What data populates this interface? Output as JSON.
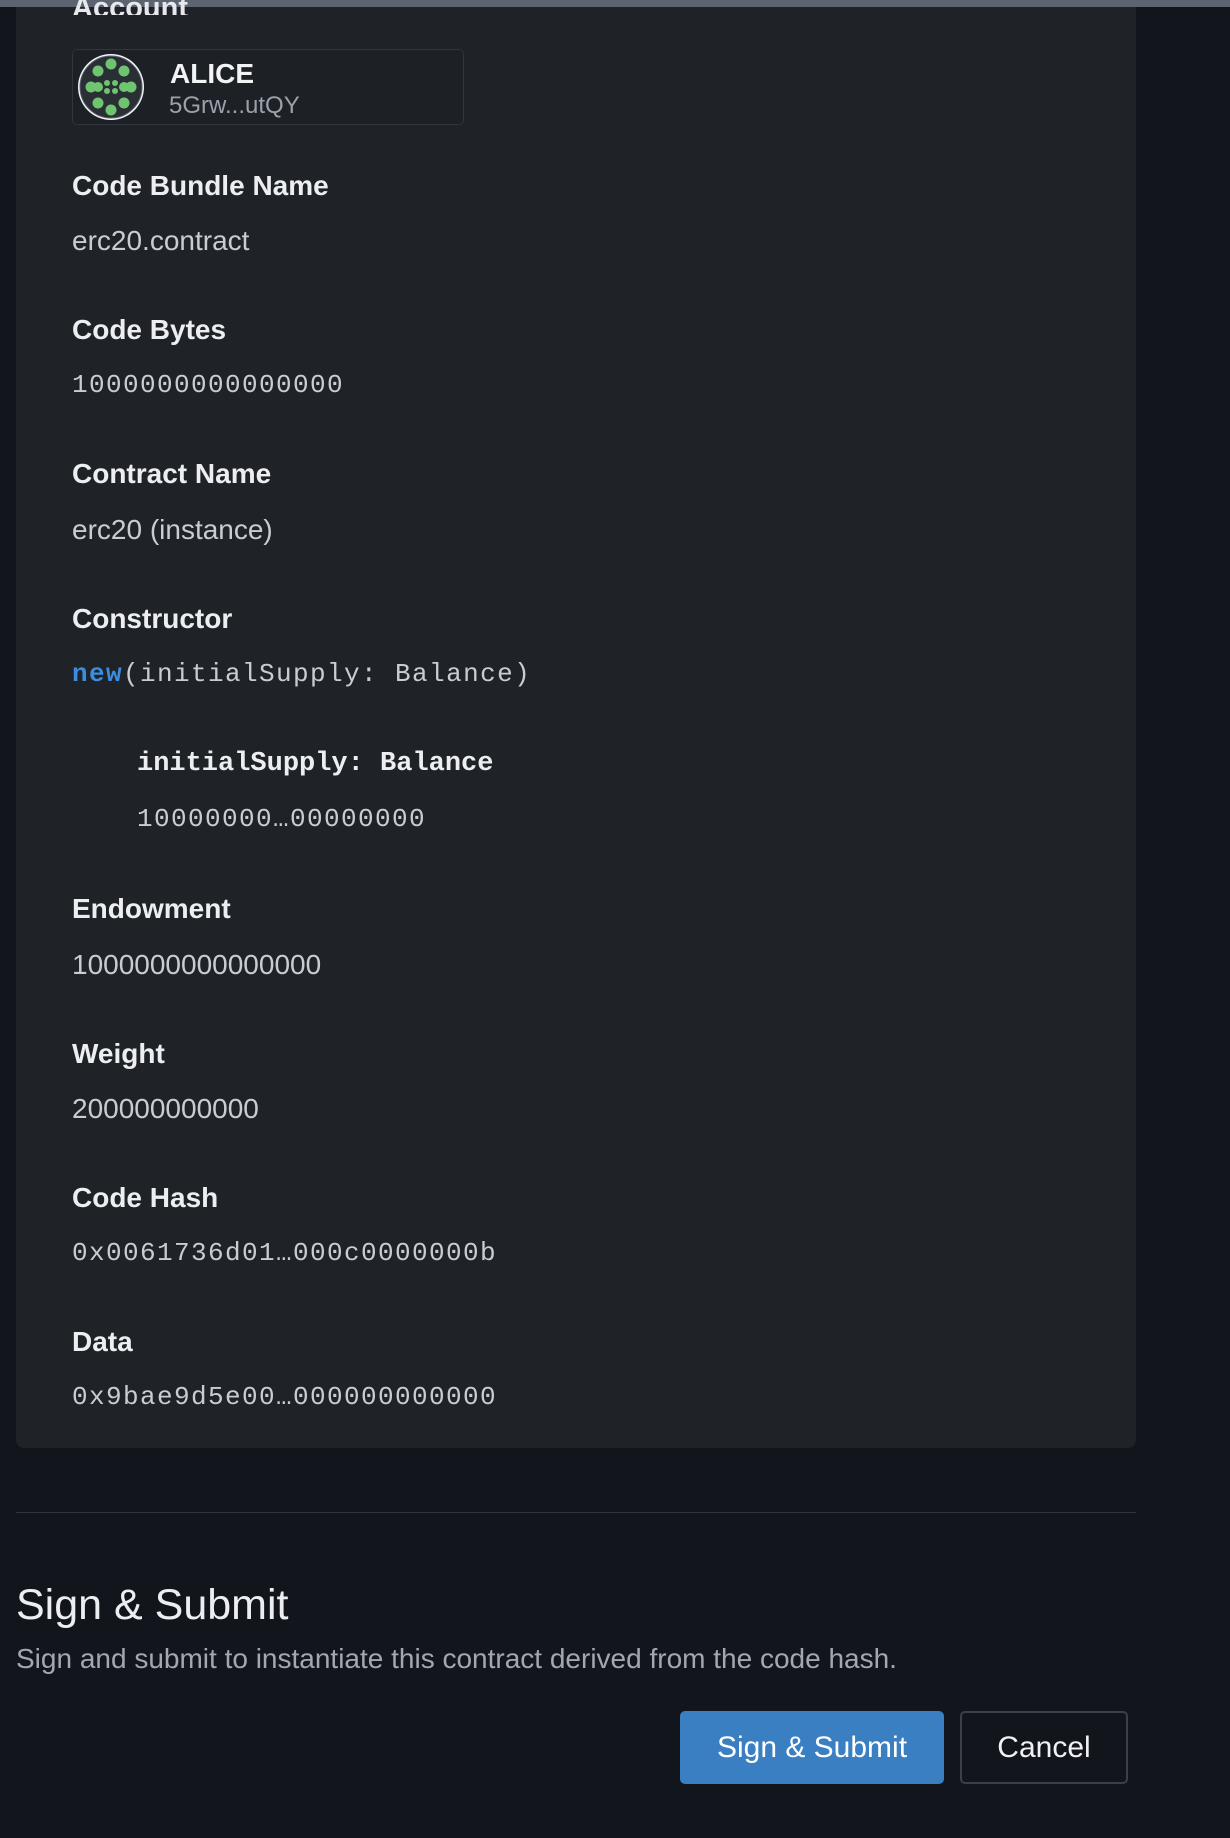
{
  "account": {
    "heading": "Account",
    "name": "ALICE",
    "address": "5Grw...utQY",
    "avatar_icon": "identicon-icon"
  },
  "fields": {
    "code_bundle_name": {
      "label": "Code Bundle Name",
      "value": "erc20.contract"
    },
    "code_bytes": {
      "label": "Code Bytes",
      "value": "1000000000000000"
    },
    "contract_name": {
      "label": "Contract Name",
      "value": "erc20 (instance)"
    },
    "constructor": {
      "label": "Constructor",
      "keyword": "new",
      "signature": "(initialSupply: Balance)",
      "arg_name": "initialSupply: Balance",
      "arg_value": "10000000…00000000"
    },
    "endowment": {
      "label": "Endowment",
      "value": "1000000000000000"
    },
    "weight": {
      "label": "Weight",
      "value": "200000000000"
    },
    "code_hash": {
      "label": "Code Hash",
      "value": "0x0061736d01…000c0000000b"
    },
    "data": {
      "label": "Data",
      "value": "0x9bae9d5e00…000000000000"
    }
  },
  "sign": {
    "title": "Sign & Submit",
    "description": "Sign and submit to instantiate this contract derived from the code hash.",
    "submit_label": "Sign & Submit",
    "cancel_label": "Cancel"
  },
  "colors": {
    "background": "#12161c",
    "card": "#1f2328",
    "accent": "#3a7fc1",
    "keyword": "#3a8de0",
    "identicon": "#6fc46f"
  }
}
